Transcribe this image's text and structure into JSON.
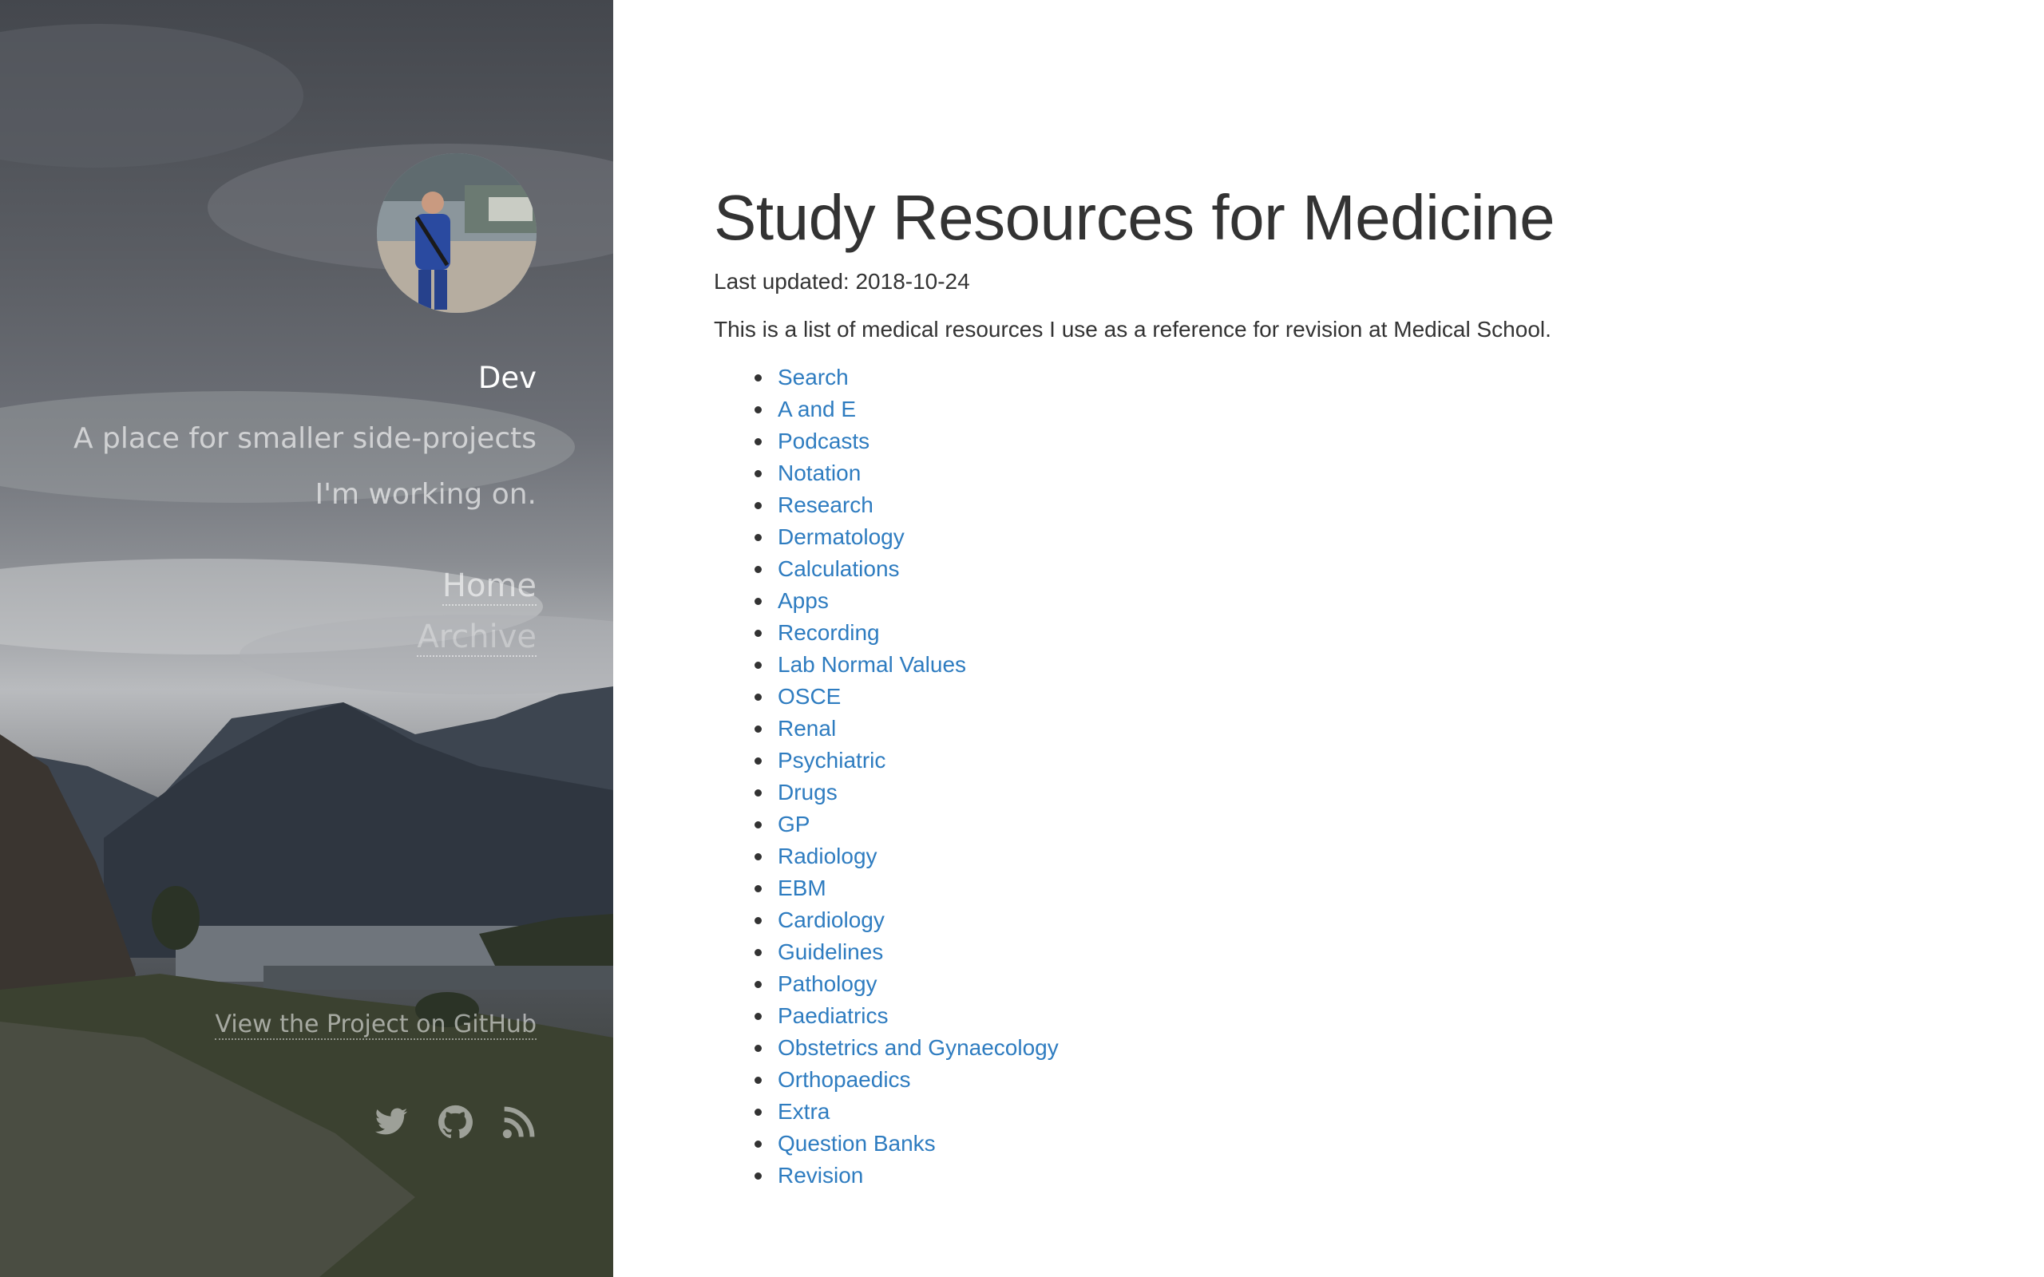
{
  "sidebar": {
    "site_title": "Dev",
    "tagline": "A place for smaller side-projects I'm working on.",
    "nav": [
      {
        "label": "Home"
      },
      {
        "label": "Archive"
      }
    ],
    "github_link": "View the Project on GitHub",
    "social_icons": [
      "twitter-icon",
      "github-icon",
      "rss-icon"
    ]
  },
  "main": {
    "title": "Study Resources for Medicine",
    "last_updated": "Last updated: 2018-10-24",
    "intro": "This is a list of medical resources I use as a reference for revision at Medical School.",
    "resources": [
      "Search",
      "A and E",
      "Podcasts",
      "Notation",
      "Research",
      "Dermatology",
      "Calculations",
      "Apps",
      "Recording",
      "Lab Normal Values",
      "OSCE",
      "Renal",
      "Psychiatric",
      "Drugs",
      "GP",
      "Radiology",
      "EBM",
      "Cardiology",
      "Guidelines",
      "Pathology",
      "Paediatrics",
      "Obstetrics and Gynaecology",
      "Orthopaedics",
      "Extra",
      "Question Banks",
      "Revision"
    ]
  },
  "colors": {
    "link": "#2e7cc0",
    "text": "#333333",
    "background": "#ffffff"
  }
}
